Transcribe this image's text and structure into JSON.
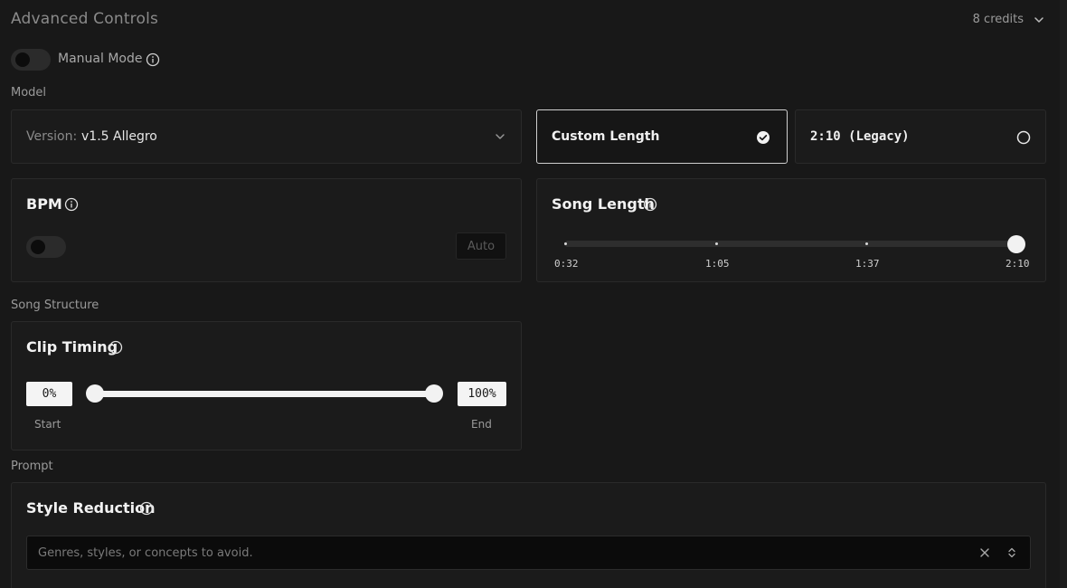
{
  "header": {
    "title": "Advanced Controls",
    "credits": "8 credits"
  },
  "manual_mode": {
    "label": "Manual Mode",
    "enabled": false
  },
  "model": {
    "section_label": "Model",
    "version_prefix": "Version:",
    "version_value": "v1.5 Allegro",
    "options": [
      {
        "label": "Custom Length",
        "selected": true
      },
      {
        "label": "2:10 (Legacy)",
        "selected": false
      }
    ]
  },
  "bpm": {
    "title": "BPM",
    "enabled": false,
    "auto_label": "Auto"
  },
  "song_length": {
    "title": "Song Length",
    "ticks": [
      "0:32",
      "1:05",
      "1:37",
      "2:10"
    ],
    "value": "2:10"
  },
  "song_structure": {
    "section_label": "Song Structure",
    "clip_timing": {
      "title": "Clip Timing",
      "start_value": "0%",
      "end_value": "100%",
      "start_label": "Start",
      "end_label": "End"
    }
  },
  "prompt": {
    "section_label": "Prompt",
    "style_reduction": {
      "title": "Style Reduction",
      "placeholder": "Genres, styles, or concepts to avoid."
    }
  },
  "colors": {
    "background": "#181818",
    "card": "#1b1b1b",
    "accent": "#f2f2f2"
  }
}
